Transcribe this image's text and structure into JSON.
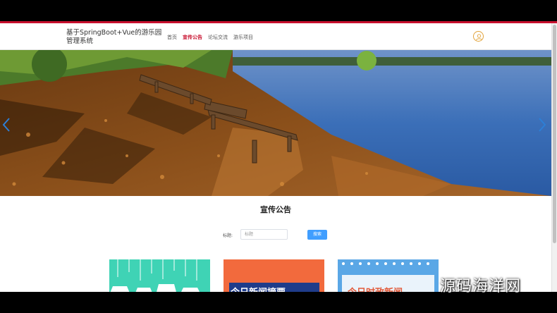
{
  "header": {
    "site_title": "基于SpringBoot+Vue的游乐园管理系统",
    "nav": [
      {
        "label": "首页"
      },
      {
        "label": "宣传公告"
      },
      {
        "label": "论坛交流"
      },
      {
        "label": "游乐项目"
      }
    ],
    "active_nav": "宣传公告",
    "accent_color": "#c8102e"
  },
  "banner": {
    "prev_icon": "chevron-left-icon",
    "next_icon": "chevron-right-icon"
  },
  "section": {
    "title": "宣传公告"
  },
  "search": {
    "label": "标题:",
    "placeholder": "标题",
    "button_label": "搜索",
    "button_color": "#409eff"
  },
  "cards": [
    {
      "title_fragment": "",
      "color": "#3fd3b5"
    },
    {
      "title_fragment": "今日新闻摘要",
      "color": "#f26a3d"
    },
    {
      "title_fragment": "今日时政新闻",
      "color": "#5aa7e6"
    }
  ],
  "watermark": "源码海洋网"
}
